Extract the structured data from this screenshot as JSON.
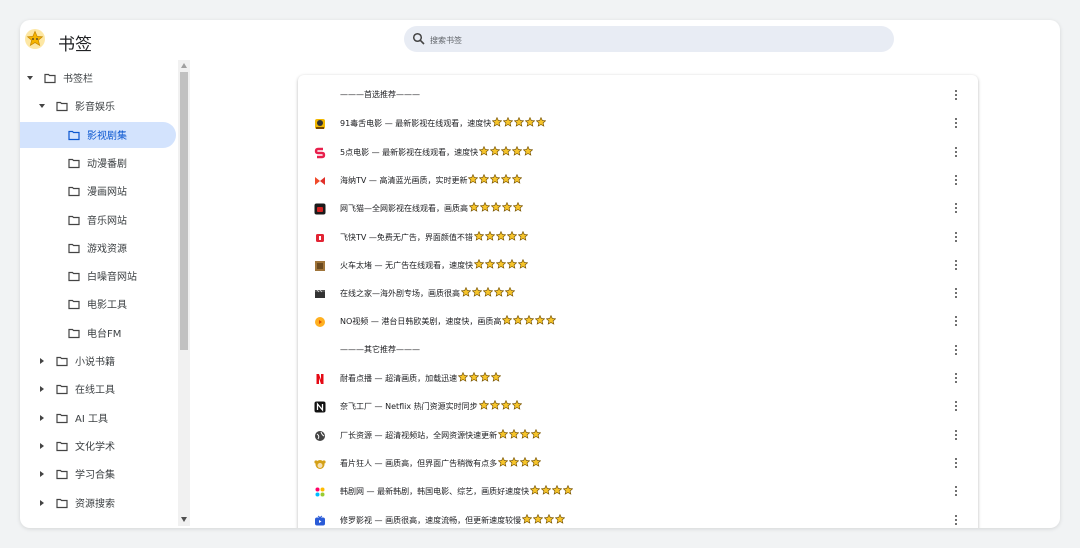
{
  "app": {
    "title": "书签"
  },
  "search": {
    "placeholder": "搜索书签"
  },
  "sidebar": {
    "items": [
      {
        "label": "书签栏",
        "level": 0,
        "arrow": "expanded",
        "selected": false
      },
      {
        "label": "影音娱乐",
        "level": 1,
        "arrow": "expanded",
        "selected": false
      },
      {
        "label": "影视剧集",
        "level": 2,
        "arrow": "none",
        "selected": true
      },
      {
        "label": "动漫番剧",
        "level": 2,
        "arrow": "none",
        "selected": false
      },
      {
        "label": "漫画网站",
        "level": 2,
        "arrow": "none",
        "selected": false
      },
      {
        "label": "音乐网站",
        "level": 2,
        "arrow": "none",
        "selected": false
      },
      {
        "label": "游戏资源",
        "level": 2,
        "arrow": "none",
        "selected": false
      },
      {
        "label": "白噪音网站",
        "level": 2,
        "arrow": "none",
        "selected": false
      },
      {
        "label": "电影工具",
        "level": 2,
        "arrow": "none",
        "selected": false
      },
      {
        "label": "电台FM",
        "level": 2,
        "arrow": "none",
        "selected": false
      },
      {
        "label": "小说书籍",
        "level": 1,
        "arrow": "collapsed",
        "selected": false
      },
      {
        "label": "在线工具",
        "level": 1,
        "arrow": "collapsed",
        "selected": false
      },
      {
        "label": "AI 工具",
        "level": 1,
        "arrow": "collapsed",
        "selected": false
      },
      {
        "label": "文化学术",
        "level": 1,
        "arrow": "collapsed",
        "selected": false
      },
      {
        "label": "学习合集",
        "level": 1,
        "arrow": "collapsed",
        "selected": false
      },
      {
        "label": "资源搜索",
        "level": 1,
        "arrow": "collapsed",
        "selected": false
      }
    ]
  },
  "bookmarks": [
    {
      "text": "———首选推荐———",
      "stars": 0,
      "icon": "none"
    },
    {
      "text": "91毒舌电影 — 最新影视在线观看，速度快",
      "stars": 5,
      "icon": "yellow-face-icon"
    },
    {
      "text": "5点电影 — 最新影视在线观看，速度快",
      "stars": 5,
      "icon": "red-s-icon"
    },
    {
      "text": "海纳TV — 高清蓝光画质，实时更新",
      "stars": 5,
      "icon": "red-bow-icon"
    },
    {
      "text": "网飞猫—全网影视在线观看，画质高",
      "stars": 5,
      "icon": "dark-red-square-icon"
    },
    {
      "text": "飞快TV —免费无广告，界面颜值不错",
      "stars": 5,
      "icon": "red-square-icon"
    },
    {
      "text": "火车太堵 — 无广告在线观看，速度快",
      "stars": 5,
      "icon": "brown-photo-icon"
    },
    {
      "text": "在线之家—海外剧专场，画质很高",
      "stars": 5,
      "icon": "clapper-icon"
    },
    {
      "text": "NO视频 — 港台日韩欧美剧，速度快，画质高",
      "stars": 5,
      "icon": "orange-play-icon"
    },
    {
      "text": "———其它推荐———",
      "stars": 0,
      "icon": "none"
    },
    {
      "text": "耐看点播 — 超清画质，加载迅速",
      "stars": 4,
      "icon": "netflix-n-icon"
    },
    {
      "text": "奈飞工厂 — Netflix 热门资源实时同步",
      "stars": 4,
      "icon": "black-n-icon"
    },
    {
      "text": "厂长资源 — 超清视频站，全网资源快速更新",
      "stars": 4,
      "icon": "globe-icon"
    },
    {
      "text": "看片狂人 — 画质高，但界面广告稍微有点多",
      "stars": 4,
      "icon": "monkey-icon"
    },
    {
      "text": "韩剧网 — 最新韩剧，韩国电影、综艺，画质好速度快",
      "stars": 4,
      "icon": "colorful-logo-icon"
    },
    {
      "text": "修罗影视 — 画质很高，速度流畅，但更新速度较慢",
      "stars": 4,
      "icon": "blue-tv-icon"
    }
  ],
  "colors": {
    "accent": "#0b57d0",
    "selected_bg": "#d3e3fd",
    "search_bg": "#e8ecf4",
    "star_fill": "#f7c52b",
    "star_stroke": "#7a5500"
  }
}
